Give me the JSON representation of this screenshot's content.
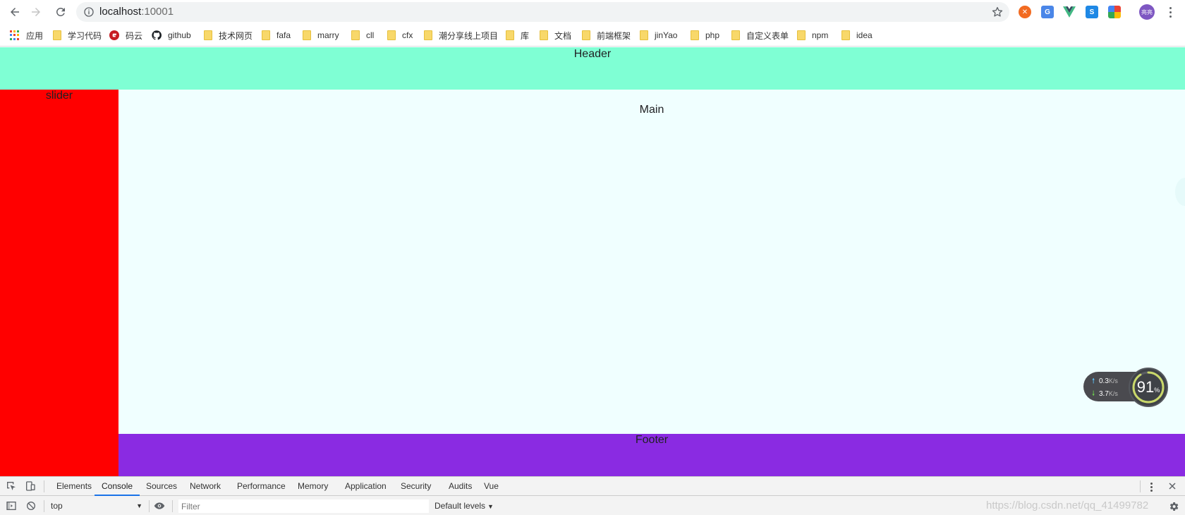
{
  "browser": {
    "url_host": "localhost",
    "url_port": ":10001"
  },
  "bookmarks": [
    {
      "label": "应用",
      "icon": "apps-grid-icon"
    },
    {
      "label": "学习代码",
      "icon": "folder-icon"
    },
    {
      "label": "码云",
      "icon": "gitee-icon"
    },
    {
      "label": "github",
      "icon": "github-icon"
    },
    {
      "label": "技术网页",
      "icon": "folder-icon"
    },
    {
      "label": "fafa",
      "icon": "folder-icon"
    },
    {
      "label": "marry",
      "icon": "folder-icon"
    },
    {
      "label": "cll",
      "icon": "folder-icon"
    },
    {
      "label": "cfx",
      "icon": "folder-icon"
    },
    {
      "label": "潮分享线上项目",
      "icon": "folder-icon"
    },
    {
      "label": "库",
      "icon": "folder-icon"
    },
    {
      "label": "文档",
      "icon": "folder-icon"
    },
    {
      "label": "前端框架",
      "icon": "folder-icon"
    },
    {
      "label": "jinYao",
      "icon": "folder-icon"
    },
    {
      "label": "php",
      "icon": "folder-icon"
    },
    {
      "label": "自定义表单",
      "icon": "folder-icon"
    },
    {
      "label": "npm",
      "icon": "folder-icon"
    },
    {
      "label": "idea",
      "icon": "folder-icon"
    }
  ],
  "profile": {
    "avatar_text": "亮亮"
  },
  "page": {
    "header": "Header",
    "slider": "slider",
    "main": "Main",
    "footer": "Footer"
  },
  "net_widget": {
    "upload": "0.3",
    "download": "3.7",
    "unit": "K/s",
    "percent": "91",
    "percent_sign": "%",
    "percent_value": 0.91
  },
  "devtools": {
    "tabs": [
      "Elements",
      "Console",
      "Sources",
      "Network",
      "Performance",
      "Memory",
      "Application",
      "Security",
      "Audits",
      "Vue"
    ],
    "active_tab": "Console",
    "context": "top",
    "filter_placeholder": "Filter",
    "levels": "Default levels",
    "watermark": "https://blog.csdn.net/qq_41499782"
  },
  "colors": {
    "header": "#7fffd4",
    "slider": "#ff0000",
    "main": "#f0ffff",
    "footer": "#8a2be2",
    "devtools_active": "#1a73e8"
  }
}
